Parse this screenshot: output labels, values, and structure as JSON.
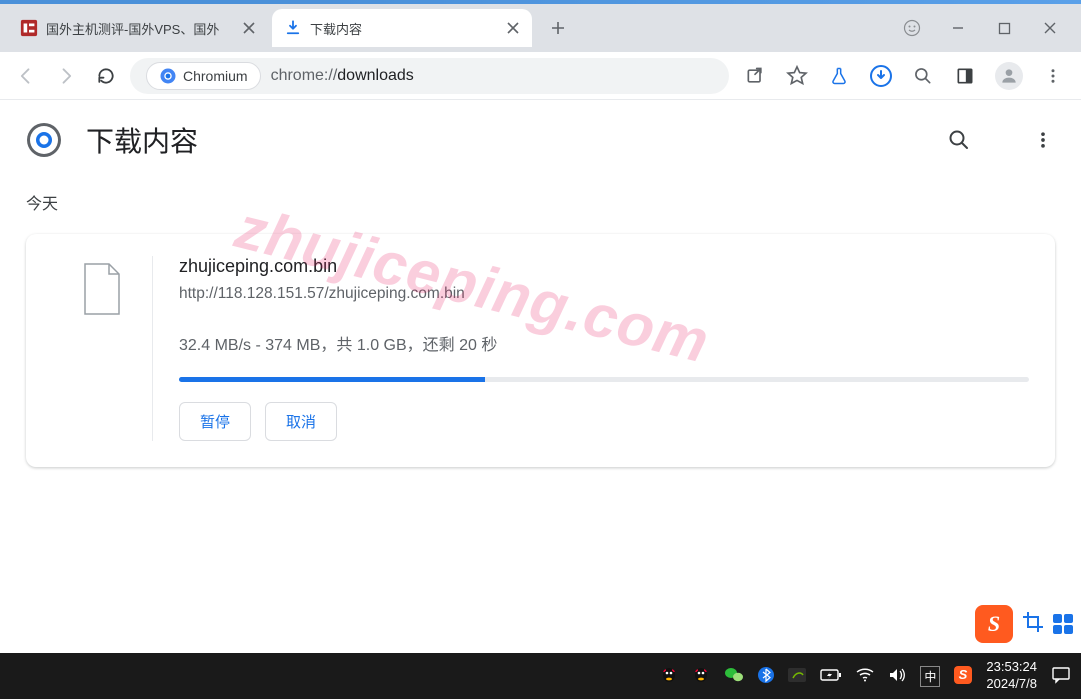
{
  "window": {
    "tabs": [
      {
        "title": "国外主机测评-国外VPS、国外",
        "favicon_color": "#b02a2a"
      },
      {
        "title": "下载内容",
        "favicon": "download"
      }
    ],
    "active_tab_index": 1
  },
  "addressbar": {
    "product": "Chromium",
    "url_prefix": "chrome://",
    "url_path": "downloads"
  },
  "page": {
    "title": "下载内容",
    "section_today": "今天"
  },
  "download": {
    "filename": "zhujiceping.com.bin",
    "source_url": "http://118.128.151.57/zhujiceping.com.bin",
    "speed": "32.4 MB/s",
    "downloaded": "374 MB",
    "total": "1.0 GB",
    "remaining": "20 秒",
    "status_separator": " - ",
    "status_total_label": "，共 ",
    "status_remaining_label": "，还剩 ",
    "progress_percent": 36,
    "pause_label": "暂停",
    "cancel_label": "取消"
  },
  "watermark": "zhujiceping.com",
  "taskbar": {
    "ime_indicator": "中",
    "time": "23:53:24",
    "date": "2024/7/8"
  },
  "sogou_glyph": "S"
}
